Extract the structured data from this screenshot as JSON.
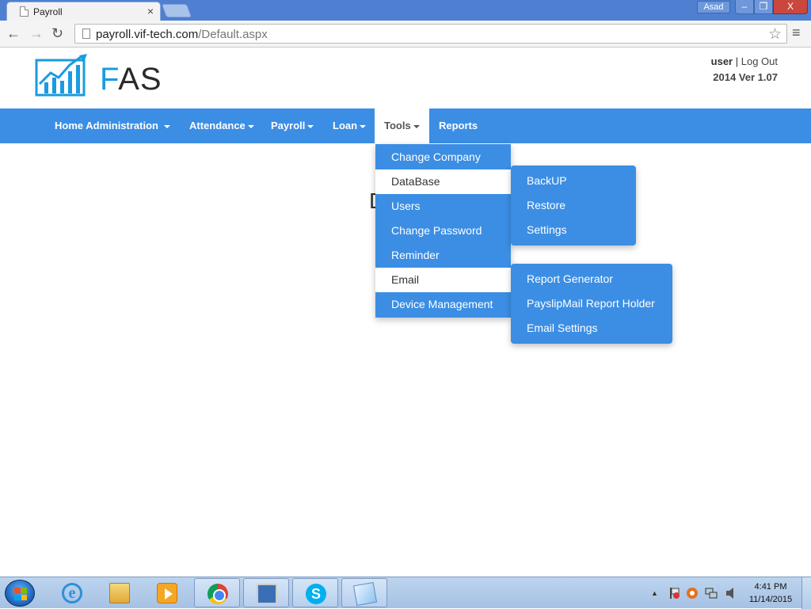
{
  "browser": {
    "tab_title": "Payroll",
    "tab_close": "×",
    "user_chip": "Asad",
    "url_host": "payroll.vif-tech.com",
    "url_path": "/Default.aspx",
    "back_glyph": "←",
    "forward_glyph": "→",
    "reload_glyph": "↻",
    "star_glyph": "☆",
    "menu_glyph": "≡",
    "min_glyph": "–",
    "max_glyph": "❐",
    "close_glyph": "X"
  },
  "header": {
    "logo_f": "F",
    "logo_rest": "AS",
    "user_name": "user",
    "separator": " | ",
    "logout": "Log Out",
    "version": "2014 Ver 1.07"
  },
  "nav": {
    "items": [
      {
        "label": "Home Administration",
        "has_caret": true
      },
      {
        "label": "Attendance",
        "has_caret": true
      },
      {
        "label": "Payroll",
        "has_caret": true
      },
      {
        "label": "Loan",
        "has_caret": true
      },
      {
        "label": "Tools",
        "has_caret": true,
        "active": true
      },
      {
        "label": "Reports",
        "has_caret": false
      }
    ]
  },
  "page": {
    "heading_partial": "D"
  },
  "tools_menu": {
    "items": [
      {
        "label": "Change Company"
      },
      {
        "label": "DataBase",
        "highlight": true
      },
      {
        "label": "Users"
      },
      {
        "label": "Change Password"
      },
      {
        "label": "Reminder"
      },
      {
        "label": "Email",
        "highlight": true
      },
      {
        "label": "Device Management"
      }
    ]
  },
  "database_submenu": {
    "items": [
      {
        "label": "BackUP"
      },
      {
        "label": "Restore"
      },
      {
        "label": "Settings"
      }
    ]
  },
  "email_submenu": {
    "items": [
      {
        "label": "Report Generator"
      },
      {
        "label": "PayslipMail Report Holder"
      },
      {
        "label": "Email Settings"
      }
    ]
  },
  "taskbar": {
    "ie_glyph": "e",
    "skype_glyph": "S",
    "tray_arrow": "▲",
    "clock_time": "4:41 PM",
    "clock_date": "11/14/2015"
  },
  "colors": {
    "brand_blue": "#3b8ee4",
    "logo_blue": "#1a9be0",
    "titlebar": "#4e7fd1"
  }
}
